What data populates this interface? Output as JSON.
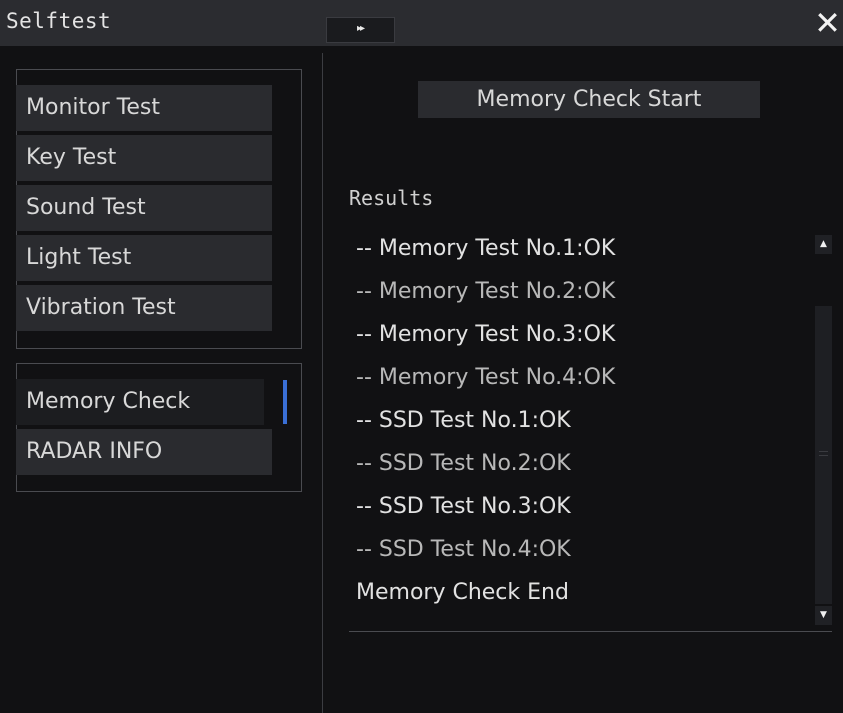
{
  "window": {
    "title": "Selftest",
    "expand_icon": "double-chevron-right-icon",
    "expand_glyph": "▸▸",
    "close_glyph": "✕"
  },
  "test_menu": {
    "items": [
      {
        "label": "Monitor Test"
      },
      {
        "label": "Key Test"
      },
      {
        "label": "Sound Test"
      },
      {
        "label": "Light Test"
      },
      {
        "label": "Vibration Test"
      }
    ]
  },
  "info_menu": {
    "items": [
      {
        "label": "Memory Check",
        "selected": true
      },
      {
        "label": "RADAR INFO",
        "selected": false
      }
    ]
  },
  "memory_check": {
    "start_button": "Memory Check Start",
    "results_label": "Results",
    "results": [
      "-- Memory Test No.1:OK",
      "-- Memory Test No.2:OK",
      "-- Memory Test No.3:OK",
      "-- Memory Test No.4:OK",
      "-- SSD Test No.1:OK",
      "-- SSD Test No.2:OK",
      "-- SSD Test No.3:OK",
      "-- SSD Test No.4:OK",
      "Memory Check End"
    ]
  },
  "scrollbar": {
    "up_glyph": "▲",
    "down_glyph": "▼"
  },
  "colors": {
    "background": "#111113",
    "panel": "#2a2b2f",
    "accent": "#3a6fd6"
  }
}
